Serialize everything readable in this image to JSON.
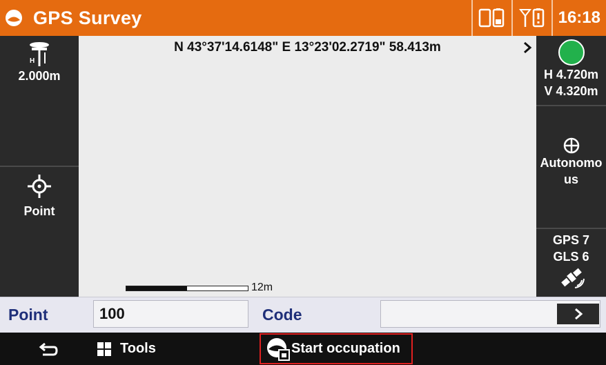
{
  "header": {
    "title": "GPS Survey",
    "time": "16:18",
    "accent": "#e56b10"
  },
  "left_panel": {
    "antenna_height": "2.000m",
    "point_label": "Point"
  },
  "right_panel": {
    "fix_status_color": "#22b14c",
    "h_precision": "H 4.720m",
    "v_precision": "V 4.320m",
    "solution_line1": "Autonomo",
    "solution_line2": "us",
    "gps_sats": "GPS 7",
    "gls_sats": "GLS 6"
  },
  "map": {
    "position": "N 43°37'14.6148\" E 13°23'02.2719\" 58.413m",
    "scale_label": "12m"
  },
  "input": {
    "point_label": "Point",
    "point_value": "100",
    "code_label": "Code",
    "code_value": ""
  },
  "bottom": {
    "tools_label": "Tools",
    "start_label": "Start occupation"
  }
}
